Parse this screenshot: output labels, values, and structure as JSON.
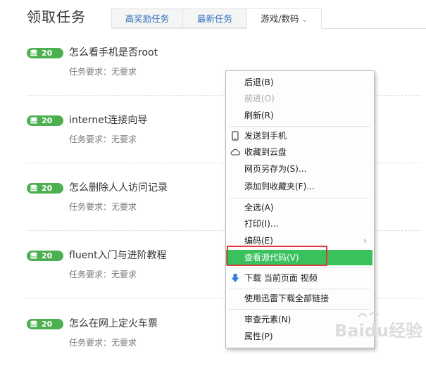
{
  "header": {
    "title": "领取任务",
    "tabs": [
      {
        "label": "高奖励任务"
      },
      {
        "label": "最新任务"
      },
      {
        "label": "游戏/数码"
      }
    ]
  },
  "tasks": [
    {
      "reward": "20",
      "title": "怎么看手机是否root",
      "requirement": "任务要求：无要求"
    },
    {
      "reward": "20",
      "title": "internet连接向导",
      "requirement": "任务要求：无要求"
    },
    {
      "reward": "20",
      "title": "怎么删除人人访问记录",
      "requirement": "任务要求：无要求"
    },
    {
      "reward": "20",
      "title": "fluent入门与进阶教程",
      "requirement": "任务要求：无要求"
    },
    {
      "reward": "20",
      "title": "怎么在网上定火车票",
      "requirement": "任务要求：无要求"
    }
  ],
  "context_menu": {
    "items": [
      {
        "label": "后退(B)"
      },
      {
        "label": "前进(O)"
      },
      {
        "label": "刷新(R)"
      },
      {
        "label": "发送到手机"
      },
      {
        "label": "收藏到云盘"
      },
      {
        "label": "网页另存为(S)..."
      },
      {
        "label": "添加到收藏夹(F)..."
      },
      {
        "label": "全选(A)"
      },
      {
        "label": "打印(I)..."
      },
      {
        "label": "编码(E)"
      },
      {
        "label": "查看源代码(V)"
      },
      {
        "label": "下载 当前页面 视频"
      },
      {
        "label": "使用迅雷下载全部链接"
      },
      {
        "label": "审查元素(N)"
      },
      {
        "label": "属性(P)"
      }
    ]
  },
  "watermark": {
    "text": "Baidu经验"
  },
  "colors": {
    "reward_badge": "#4caf50",
    "menu_highlight": "#39c15d",
    "annotation_box": "#e03a3a",
    "tab_link": "#2a6fb8"
  }
}
